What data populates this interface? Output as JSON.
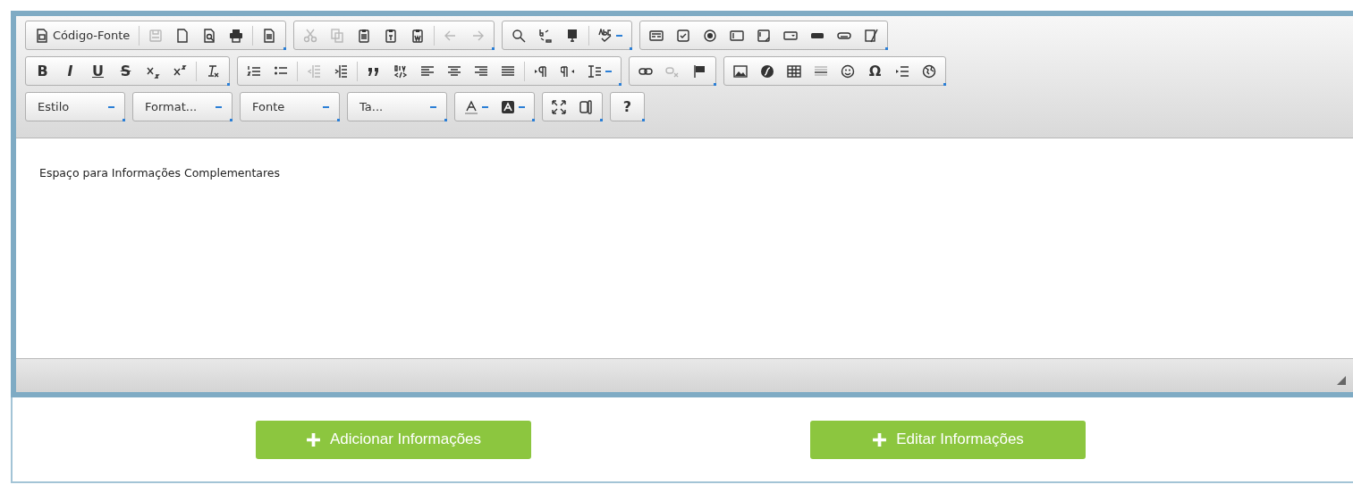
{
  "editor": {
    "toolbar": {
      "rows": [
        [
          {
            "items": [
              {
                "kind": "icon",
                "label": "Código-Fonte",
                "disabled": false
              },
              {
                "kind": "sep"
              },
              {
                "kind": "icon",
                "disabled": true
              },
              {
                "kind": "icon",
                "disabled": false
              },
              {
                "kind": "icon",
                "disabled": false
              },
              {
                "kind": "icon",
                "disabled": false
              },
              {
                "kind": "sep"
              },
              {
                "kind": "icon",
                "disabled": false
              }
            ]
          },
          {
            "items": [
              {
                "kind": "icon",
                "disabled": true
              },
              {
                "kind": "icon",
                "disabled": true
              },
              {
                "kind": "icon",
                "disabled": false
              },
              {
                "kind": "icon",
                "disabled": false
              },
              {
                "kind": "icon",
                "disabled": false
              },
              {
                "kind": "sep"
              },
              {
                "kind": "icon",
                "disabled": true
              },
              {
                "kind": "icon",
                "disabled": true
              }
            ]
          },
          {
            "items": [
              {
                "kind": "icon",
                "disabled": false
              },
              {
                "kind": "icon",
                "disabled": false
              },
              {
                "kind": "icon",
                "disabled": false
              },
              {
                "kind": "sep"
              },
              {
                "kind": "icon",
                "disabled": false,
                "menu": true
              }
            ]
          },
          {
            "items": [
              {
                "kind": "icon",
                "disabled": false
              },
              {
                "kind": "icon",
                "disabled": false
              },
              {
                "kind": "icon",
                "disabled": false
              },
              {
                "kind": "icon",
                "disabled": false
              },
              {
                "kind": "icon",
                "disabled": false
              },
              {
                "kind": "icon",
                "disabled": false
              },
              {
                "kind": "icon",
                "disabled": false
              },
              {
                "kind": "icon",
                "disabled": false
              },
              {
                "kind": "icon",
                "disabled": false
              }
            ]
          }
        ],
        [
          {
            "items": [
              {
                "kind": "glyph",
                "label": "B",
                "disabled": false
              },
              {
                "kind": "glyph",
                "label": "I",
                "disabled": false
              },
              {
                "kind": "glyph",
                "label": "U",
                "disabled": false
              },
              {
                "kind": "glyph",
                "label": "S",
                "disabled": false
              },
              {
                "kind": "icon",
                "disabled": false
              },
              {
                "kind": "icon",
                "disabled": false
              },
              {
                "kind": "sep"
              },
              {
                "kind": "icon",
                "disabled": false
              }
            ]
          },
          {
            "items": [
              {
                "kind": "icon",
                "disabled": false
              },
              {
                "kind": "icon",
                "disabled": false
              },
              {
                "kind": "sep"
              },
              {
                "kind": "icon",
                "disabled": true
              },
              {
                "kind": "icon",
                "disabled": false
              },
              {
                "kind": "sep"
              },
              {
                "kind": "icon",
                "disabled": false
              },
              {
                "kind": "icon",
                "disabled": false
              },
              {
                "kind": "icon",
                "disabled": false
              },
              {
                "kind": "icon",
                "disabled": false
              },
              {
                "kind": "icon",
                "disabled": false
              },
              {
                "kind": "icon",
                "disabled": false
              },
              {
                "kind": "sep"
              },
              {
                "kind": "icon",
                "disabled": false
              },
              {
                "kind": "icon",
                "disabled": false
              },
              {
                "kind": "icon",
                "disabled": false,
                "menu": true
              }
            ]
          },
          {
            "items": [
              {
                "kind": "icon",
                "disabled": false
              },
              {
                "kind": "icon",
                "disabled": true
              },
              {
                "kind": "icon",
                "disabled": false
              }
            ]
          },
          {
            "items": [
              {
                "kind": "icon",
                "disabled": false
              },
              {
                "kind": "icon",
                "disabled": false
              },
              {
                "kind": "icon",
                "disabled": false
              },
              {
                "kind": "icon",
                "disabled": false
              },
              {
                "kind": "icon",
                "disabled": false
              },
              {
                "kind": "glyph",
                "label": "Ω",
                "disabled": false
              },
              {
                "kind": "icon",
                "disabled": false
              },
              {
                "kind": "icon",
                "disabled": false
              }
            ]
          }
        ],
        [
          {
            "items": [
              {
                "kind": "combo",
                "label": "Estilo"
              }
            ]
          },
          {
            "items": [
              {
                "kind": "combo",
                "label": "Format..."
              }
            ]
          },
          {
            "items": [
              {
                "kind": "combo",
                "label": "Fonte"
              }
            ]
          },
          {
            "items": [
              {
                "kind": "combo",
                "label": "Ta..."
              }
            ]
          },
          {
            "items": [
              {
                "kind": "icon",
                "disabled": false,
                "menu": true
              },
              {
                "kind": "icon",
                "disabled": false,
                "menu": true
              }
            ]
          },
          {
            "items": [
              {
                "kind": "icon",
                "disabled": false
              },
              {
                "kind": "icon",
                "disabled": false
              }
            ]
          },
          {
            "items": [
              {
                "kind": "glyph",
                "label": "?",
                "disabled": false
              }
            ]
          }
        ]
      ]
    },
    "content": "Espaço para Informações Complementares"
  },
  "buttons": [
    {
      "label": "Adicionar Informações"
    },
    {
      "label": "Editar Informações"
    }
  ]
}
